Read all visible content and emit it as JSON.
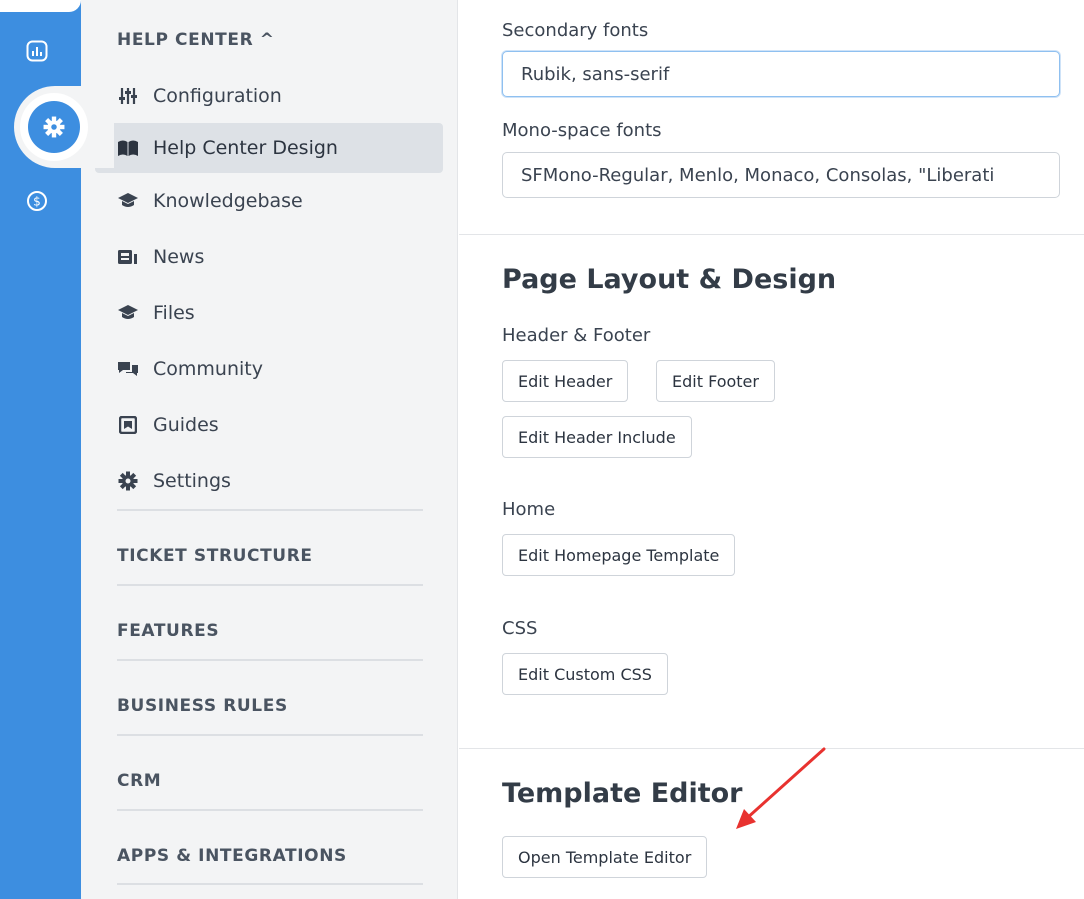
{
  "rail": {
    "icons": [
      "bar-chart-icon",
      "gear-icon",
      "dollar-icon"
    ],
    "accent": "#3d8ee0"
  },
  "sidebar": {
    "help_center_header": "HELP CENTER ^",
    "items": [
      {
        "label": "Configuration",
        "icon": "sliders-icon"
      },
      {
        "label": "Help Center Design",
        "icon": "book-open-icon",
        "active": true
      },
      {
        "label": "Knowledgebase",
        "icon": "graduation-cap-icon"
      },
      {
        "label": "News",
        "icon": "newspaper-icon"
      },
      {
        "label": "Files",
        "icon": "graduation-cap-icon"
      },
      {
        "label": "Community",
        "icon": "chat-bubbles-icon"
      },
      {
        "label": "Guides",
        "icon": "book-icon"
      },
      {
        "label": "Settings",
        "icon": "gear-icon"
      }
    ],
    "sections": [
      "TICKET STRUCTURE",
      "FEATURES",
      "BUSINESS RULES",
      "CRM",
      "APPS & INTEGRATIONS"
    ]
  },
  "main": {
    "secondary_fonts_label": "Secondary fonts",
    "secondary_fonts_value": "Rubik, sans-serif",
    "mono_fonts_label": "Mono-space fonts",
    "mono_fonts_value": "SFMono-Regular, Menlo, Monaco, Consolas, \"Liberati",
    "layout_title": "Page Layout & Design",
    "header_footer_label": "Header & Footer",
    "edit_header": "Edit Header",
    "edit_footer": "Edit Footer",
    "edit_header_include": "Edit Header Include",
    "home_label": "Home",
    "edit_homepage_template": "Edit Homepage Template",
    "css_label": "CSS",
    "edit_custom_css": "Edit Custom CSS",
    "template_editor_title": "Template Editor",
    "open_template_editor": "Open Template Editor"
  },
  "annotation": {
    "arrow_color": "#e8322f"
  }
}
